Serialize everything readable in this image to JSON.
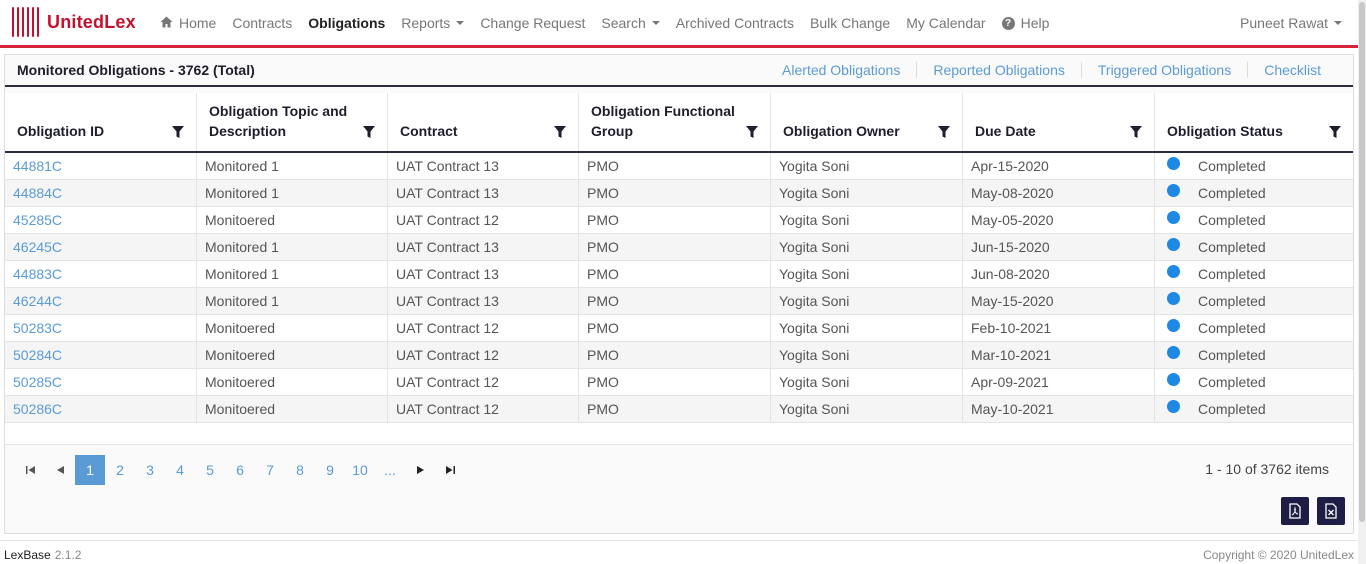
{
  "nav": {
    "brand": "UnitedLex",
    "items": [
      {
        "label": "Home",
        "icon": "home-icon"
      },
      {
        "label": "Contracts"
      },
      {
        "label": "Obligations",
        "active": true
      },
      {
        "label": "Reports",
        "dropdown": true
      },
      {
        "label": "Change Request"
      },
      {
        "label": "Search",
        "dropdown": true
      },
      {
        "label": "Archived Contracts"
      },
      {
        "label": "Bulk Change"
      },
      {
        "label": "My Calendar"
      },
      {
        "label": "Help",
        "icon": "help-icon"
      }
    ],
    "user": "Puneet Rawat"
  },
  "panel": {
    "title": "Monitored Obligations - 3762 (Total)",
    "links": [
      "Alerted Obligations",
      "Reported Obligations",
      "Triggered Obligations",
      "Checklist"
    ]
  },
  "table": {
    "columns": [
      "Obligation ID",
      "Obligation Topic and Description",
      "Contract",
      "Obligation Functional Group",
      "Obligation Owner",
      "Due Date",
      "Obligation Status"
    ],
    "rows": [
      [
        "44881C",
        "Monitored 1",
        "UAT Contract 13",
        "PMO",
        "Yogita Soni",
        "Apr-15-2020",
        "Completed"
      ],
      [
        "44884C",
        "Monitored 1",
        "UAT Contract 13",
        "PMO",
        "Yogita Soni",
        "May-08-2020",
        "Completed"
      ],
      [
        "45285C",
        "Monitoered",
        "UAT Contract 12",
        "PMO",
        "Yogita Soni",
        "May-05-2020",
        "Completed"
      ],
      [
        "46245C",
        "Monitored 1",
        "UAT Contract 13",
        "PMO",
        "Yogita Soni",
        "Jun-15-2020",
        "Completed"
      ],
      [
        "44883C",
        "Monitored 1",
        "UAT Contract 13",
        "PMO",
        "Yogita Soni",
        "Jun-08-2020",
        "Completed"
      ],
      [
        "46244C",
        "Monitored 1",
        "UAT Contract 13",
        "PMO",
        "Yogita Soni",
        "May-15-2020",
        "Completed"
      ],
      [
        "50283C",
        "Monitoered",
        "UAT Contract 12",
        "PMO",
        "Yogita Soni",
        "Feb-10-2021",
        "Completed"
      ],
      [
        "50284C",
        "Monitoered",
        "UAT Contract 12",
        "PMO",
        "Yogita Soni",
        "Mar-10-2021",
        "Completed"
      ],
      [
        "50285C",
        "Monitoered",
        "UAT Contract 12",
        "PMO",
        "Yogita Soni",
        "Apr-09-2021",
        "Completed"
      ],
      [
        "50286C",
        "Monitoered",
        "UAT Contract 12",
        "PMO",
        "Yogita Soni",
        "May-10-2021",
        "Completed"
      ]
    ],
    "status_color": "#1e88e5"
  },
  "pager": {
    "pages": [
      "1",
      "2",
      "3",
      "4",
      "5",
      "6",
      "7",
      "8",
      "9",
      "10",
      "..."
    ],
    "current": "1",
    "info": "1 - 10 of 3762 items"
  },
  "footer": {
    "product": "LexBase",
    "version": "2.1.2",
    "copyright": "Copyright © 2020 UnitedLex"
  },
  "colors": {
    "brand": "#c8102e",
    "link": "#5b9bd5",
    "dark": "#1d1d45"
  }
}
